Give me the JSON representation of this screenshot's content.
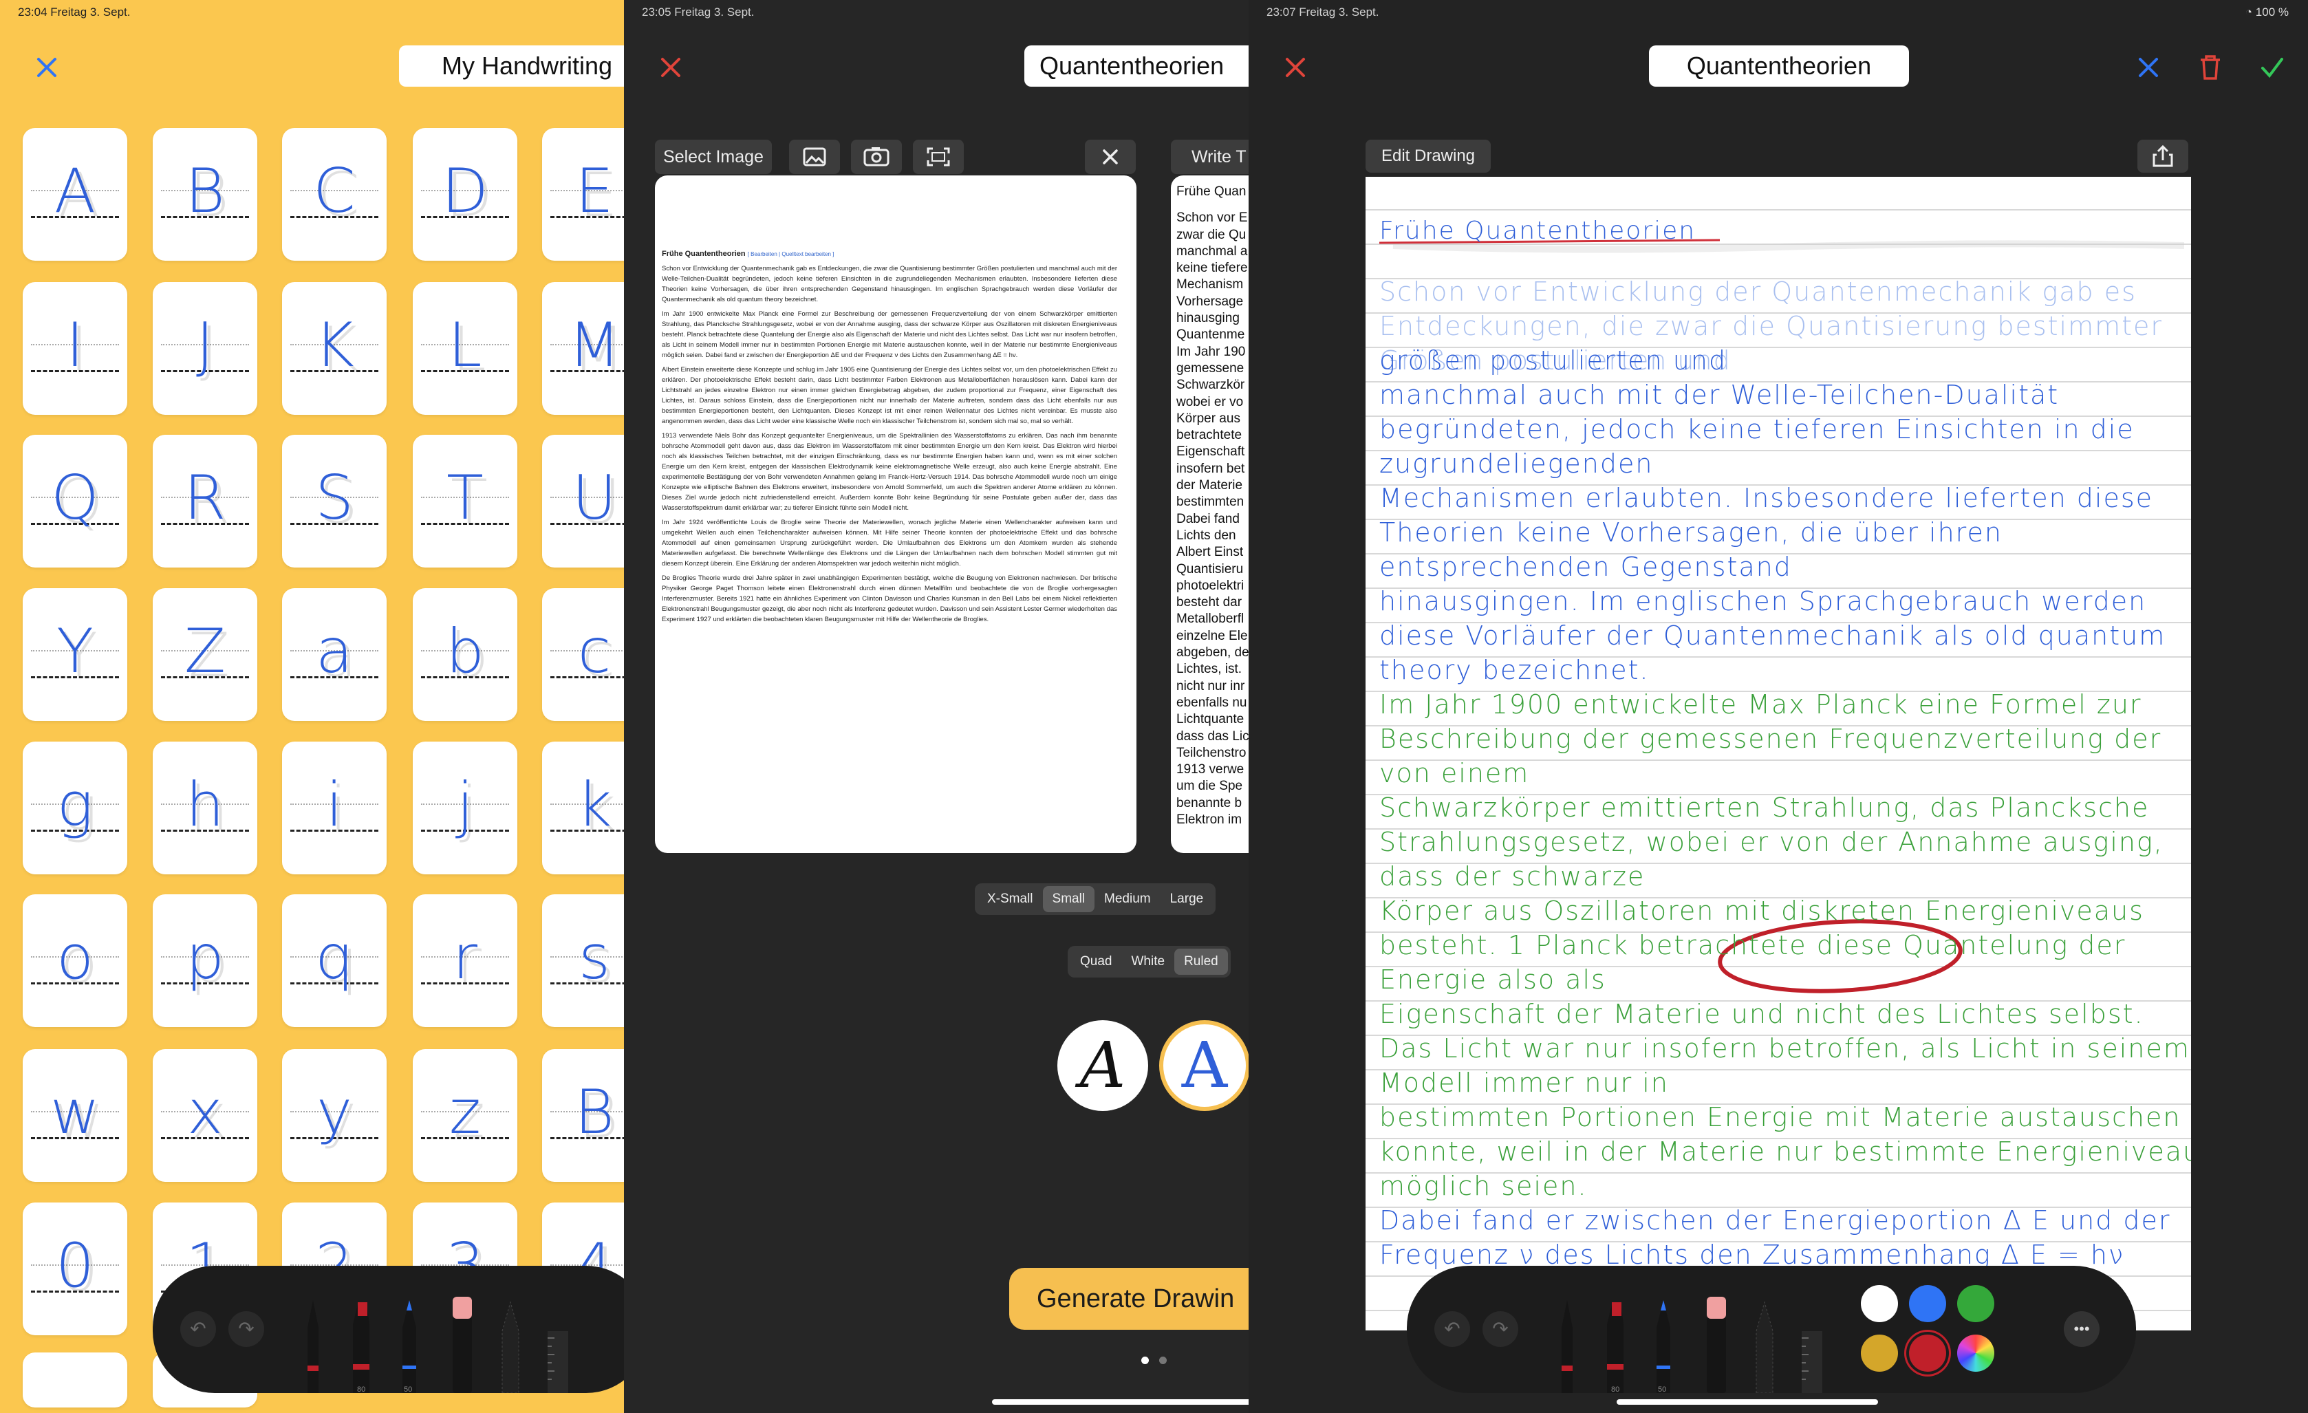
{
  "panel1": {
    "status_time": "23:04  Freitag 3. Sept.",
    "title": "My Handwriting",
    "letters": [
      "A",
      "B",
      "C",
      "D",
      "E",
      "I",
      "J",
      "K",
      "L",
      "M",
      "Q",
      "R",
      "S",
      "T",
      "U",
      "Y",
      "Z",
      "a",
      "b",
      "c",
      "g",
      "h",
      "i",
      "j",
      "k",
      "o",
      "p",
      "q",
      "r",
      "s",
      "w",
      "x",
      "y",
      "z",
      "B",
      "0",
      "1",
      "2",
      "3",
      "4"
    ]
  },
  "panel2": {
    "status_time": "23:05  Freitag 3. Sept.",
    "title": "Quantentheorien",
    "select_image": "Select Image",
    "write_tab": "Write T",
    "size_options": [
      "X-Small",
      "Small",
      "Medium",
      "Large"
    ],
    "size_selected": "Small",
    "paper_options": [
      "Quad",
      "White",
      "Ruled"
    ],
    "paper_selected": "Ruled",
    "font_sample": "A",
    "generate_label": "Generate Drawin",
    "doc": {
      "heading": "Frühe Quantentheorien",
      "edit_links": "[ Bearbeiten | Quelltext bearbeiten ]",
      "paragraphs": [
        "Schon vor Entwicklung der Quantenmechanik gab es Entdeckungen, die zwar die Quantisierung bestimmter Größen postulierten und manchmal auch mit der Welle-Teilchen-Dualität begründeten, jedoch keine tieferen Einsichten in die zugrundeliegenden Mechanismen erlaubten. Insbesondere lieferten diese Theorien keine Vorhersagen, die über ihren entsprechenden Gegenstand hinausgingen. Im englischen Sprachgebrauch werden diese Vorläufer der Quantenmechanik als old quantum theory bezeichnet.",
        "Im Jahr 1900 entwickelte Max Planck eine Formel zur Beschreibung der gemessenen Frequenzverteilung der von einem Schwarzkörper emittierten Strahlung, das Plancksche Strahlungsgesetz, wobei er von der Annahme ausging, dass der schwarze Körper aus Oszillatoren mit diskreten Energieniveaus besteht. Planck betrachtete diese Quantelung der Energie also als Eigenschaft der Materie und nicht des Lichtes selbst. Das Licht war nur insofern betroffen, als Licht in seinem Modell immer nur in bestimmten Portionen Energie mit Materie austauschen konnte, weil in der Materie nur bestimmte Energieniveaus möglich seien. Dabei fand er zwischen der Energieportion ΔE und der Frequenz ν des Lichts den Zusammenhang ΔE = hν.",
        "Albert Einstein erweiterte diese Konzepte und schlug im Jahr 1905 eine Quantisierung der Energie des Lichtes selbst vor, um den photoelektrischen Effekt zu erklären. Der photoelektrische Effekt besteht darin, dass Licht bestimmter Farben Elektronen aus Metalloberflächen herauslösen kann. Dabei kann der Lichtstrahl an jedes einzelne Elektron nur einen immer gleichen Energiebetrag abgeben, der zudem proportional zur Frequenz, einer Eigenschaft des Lichtes, ist. Daraus schloss Einstein, dass die Energieportionen nicht nur innerhalb der Materie auftreten, sondern dass das Licht ebenfalls nur aus bestimmten Energieportionen besteht, den Lichtquanten. Dieses Konzept ist mit einer reinen Wellennatur des Lichtes nicht vereinbar. Es musste also angenommen werden, dass das Licht weder eine klassische Welle noch ein klassischer Teilchenstrom ist, sondern sich mal so, mal so verhält.",
        "1913 verwendete Niels Bohr das Konzept gequantelter Energieniveaus, um die Spektrallinien des Wasserstoffatoms zu erklären. Das nach ihm benannte bohrsche Atommodell geht davon aus, dass das Elektron im Wasserstoffatom mit einer bestimmten Energie um den Kern kreist. Das Elektron wird hierbei noch als klassisches Teilchen betrachtet, mit der einzigen Einschränkung, dass es nur bestimmte Energien haben kann und, wenn es mit einer solchen Energie um den Kern kreist, entgegen der klassischen Elektrodynamik keine elektromagnetische Welle erzeugt, also auch keine Energie abstrahlt. Eine experimentelle Bestätigung der von Bohr verwendeten Annahmen gelang im Franck-Hertz-Versuch 1914. Das bohrsche Atommodell wurde noch um einige Konzepte wie elliptische Bahnen des Elektrons erweitert, insbesondere von Arnold Sommerfeld, um auch die Spektren anderer Atome erklären zu können. Dieses Ziel wurde jedoch nicht zufriedenstellend erreicht. Außerdem konnte Bohr keine Begründung für seine Postulate geben außer der, dass das Wasserstoffspektrum damit erklärbar war; zu tieferer Einsicht führte sein Modell nicht.",
        "Im Jahr 1924 veröffentlichte Louis de Broglie seine Theorie der Materiewellen, wonach jegliche Materie einen Wellencharakter aufweisen kann und umgekehrt Wellen auch einen Teilchencharakter aufweisen können. Mit Hilfe seiner Theorie konnten der photoelektrische Effekt und das bohrsche Atommodell auf einen gemeinsamen Ursprung zurückgeführt werden. Die Umlaufbahnen des Elektrons um den Atomkern wurden als stehende Materiewellen aufgefasst. Die berechnete Wellenlänge des Elektrons und die Längen der Umlaufbahnen nach dem bohrschen Modell stimmten gut mit diesem Konzept überein. Eine Erklärung der anderen Atomspektren war jedoch weiterhin nicht möglich.",
        "De Broglies Theorie wurde drei Jahre später in zwei unabhängigen Experimenten bestätigt, welche die Beugung von Elektronen nachwiesen. Der britische Physiker George Paget Thomson leitete einen Elektronenstrahl durch einen dünnen Metallfilm und beobachtete die von de Broglie vorhergesagten Interferenzmuster. Bereits 1921 hatte ein ähnliches Experiment von Clinton Davisson und Charles Kunsman in den Bell Labs bei einem Nickel reflektierten Elektronenstrahl Beugungsmuster gezeigt, die aber noch nicht als Interferenz gedeutet wurden. Davisson und sein Assistent Lester Germer wiederholten das Experiment 1927 und erklärten die beobachteten klaren Beugungsmuster mit Hilfe der Wellentheorie de Broglies."
      ]
    },
    "write_preview": [
      "Frühe Quan",
      "Schon vor E",
      "zwar die Qu",
      "manchmal a",
      "keine tiefere",
      "Mechanism",
      "Vorhersage",
      "hinausging",
      "Quantenme",
      "Im Jahr 190",
      "gemessene",
      "Schwarzkör",
      "wobei er vo",
      "Körper aus",
      "betrachtete",
      "Eigenschaft",
      "insofern bet",
      "der Materie",
      "bestimmten",
      "Dabei fand",
      "Lichts den",
      "Albert Einst",
      "Quantisieru",
      "photoelektri",
      "besteht dar",
      "Metalloberfl",
      "einzelne Ele",
      "abgeben, de",
      "Lichtes, ist.",
      "nicht nur inr",
      "ebenfalls nu",
      "Lichtquante",
      "dass das Lic",
      "Teilchenstro",
      "1913 verwe",
      "um die Spe",
      "benannte b",
      "Elektron im"
    ]
  },
  "panel3": {
    "status_time": "23:07  Freitag 3. Sept.",
    "battery": "100 %",
    "title": "Quantentheorien",
    "edit_drawing": "Edit Drawing",
    "heading": "Frühe Quantentheorien",
    "lines_faded": [
      "Schon vor Entwicklung der Quantenmechanik gab es",
      "Entdeckungen, die zwar die Quantisierung bestimmter",
      "Größen postulierten und"
    ],
    "lines_blue": [
      "größen postulierten und",
      "manchmal auch mit der Welle-Teilchen-Dualität",
      "begründeten, jedoch keine tieferen Einsichten in die",
      "zugrundeliegenden",
      "Mechanismen erlaubten. Insbesondere lieferten diese",
      "Theorien keine Vorhersagen, die über ihren",
      "entsprechenden Gegenstand",
      "hinausgingen. Im englischen Sprachgebrauch werden",
      "diese Vorläufer der Quantenmechanik als old quantum",
      "theory bezeichnet."
    ],
    "lines_green": [
      "Im Jahr 1900 entwickelte Max Planck eine Formel zur",
      "Beschreibung der gemessenen Frequenzverteilung der",
      "von einem",
      "Schwarzkörper emittierten Strahlung, das Plancksche",
      "Strahlungsgesetz, wobei er von der Annahme ausging,",
      "dass der schwarze",
      "Körper aus Oszillatoren mit diskreten Energieniveaus",
      "besteht. 1 Planck betrachtete diese Quantelung der",
      "Energie also als",
      "Eigenschaft der Materie und nicht des Lichtes selbst.",
      "Das Licht war nur insofern betroffen, als Licht in seinem",
      "Modell immer nur in",
      "bestimmten Portionen Energie mit Materie austauschen",
      "konnte, weil in der Materie nur bestimmte Energieniveaus",
      "möglich seien."
    ],
    "lines_blue2": [
      "Dabei fand er zwischen der Energieportion Δ E und der",
      "Frequenz ν des Lichts den Zusammenhang Δ E = hν"
    ]
  },
  "colors": {
    "yellow": "#fbc74f",
    "ink_blue": "#2f5fd8",
    "ink_green": "#3aa03a",
    "ink_red": "#c0202a",
    "accent_red": "#e0443a",
    "accent_blue": "#2f74f5",
    "accent_green": "#34c759"
  },
  "tool_labels": {
    "marker": "80",
    "pen": "50"
  }
}
